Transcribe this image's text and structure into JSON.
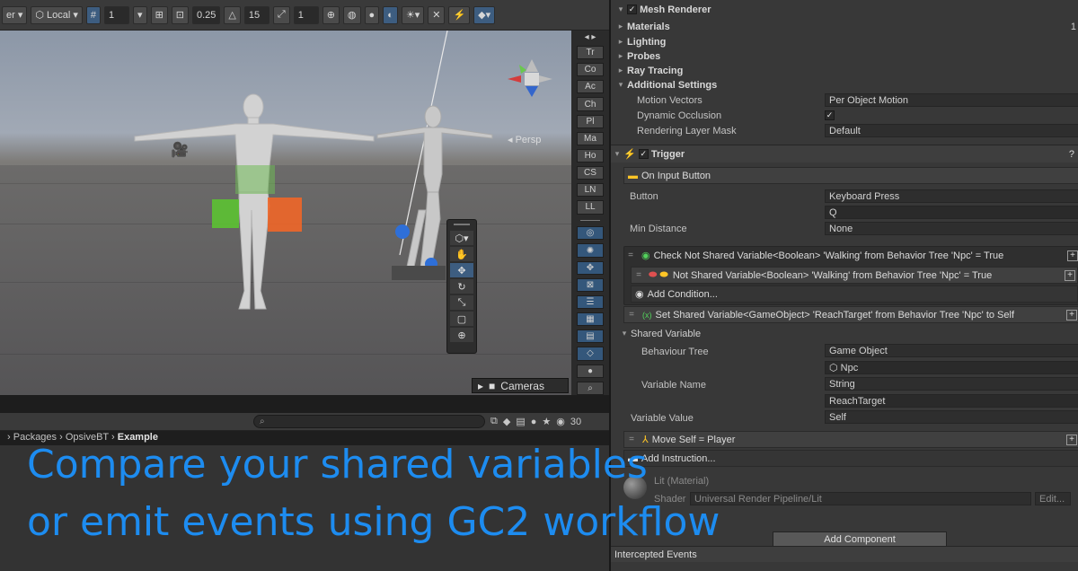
{
  "scene_toolbar": {
    "pivot_label": "er",
    "space_label": "Local",
    "grid_value": "1",
    "snap_value": "0.25",
    "rotate_snap": "15",
    "scale_snap": "1"
  },
  "scene": {
    "persp_label": "Persp",
    "cameras_label": "Cameras",
    "tools": [
      "hand-icon",
      "move-icon",
      "rotate-icon",
      "scale-icon",
      "rect-icon",
      "transform-icon"
    ],
    "overlay_buttons": [
      "Tr",
      "Co",
      "Ac",
      "Ch",
      "Pl",
      "Ma",
      "Ho",
      "CS",
      "LN",
      "LL"
    ]
  },
  "project": {
    "count": "30",
    "breadcrumb": [
      "Packages",
      "OpsiveBT",
      "Example"
    ]
  },
  "caption": {
    "line1": "Compare your shared variables",
    "line2": "or emit events using GC2 workflow"
  },
  "inspector": {
    "mesh_renderer": "Mesh Renderer",
    "top_count": "1",
    "sections": [
      "Materials",
      "Lighting",
      "Probes",
      "Ray Tracing",
      "Additional Settings"
    ],
    "motion_vectors_label": "Motion Vectors",
    "motion_vectors_value": "Per Object Motion",
    "dynamic_occlusion_label": "Dynamic Occlusion",
    "rendering_layer_mask_label": "Rendering Layer Mask",
    "rendering_layer_mask_value": "Default",
    "trigger_title": "Trigger",
    "on_input_button": "On Input Button",
    "button_label": "Button",
    "button_value": "Keyboard Press",
    "key_value": "Q",
    "min_distance_label": "Min Distance",
    "min_distance_value": "None",
    "condition_header": "Check Not Shared Variable<Boolean> 'Walking' from Behavior Tree 'Npc' = True",
    "condition_item": "Not Shared Variable<Boolean> 'Walking' from Behavior Tree 'Npc' = True",
    "add_condition": "Add Condition...",
    "set_instruction": "Set Shared Variable<GameObject> 'ReachTarget' from Behavior Tree 'Npc' to Self",
    "shared_variable_label": "Shared Variable",
    "behaviour_tree_label": "Behaviour Tree",
    "behaviour_tree_value": "Game Object",
    "npc_value": "Npc",
    "variable_name_label": "Variable Name",
    "variable_name_type": "String",
    "variable_name_value": "ReachTarget",
    "variable_value_label": "Variable Value",
    "variable_value_value": "Self",
    "move_instruction": "Move Self = Player",
    "add_instruction": "Add Instruction...",
    "material_name": "Lit (Material)",
    "shader_label": "Shader",
    "shader_value": "Universal Render Pipeline/Lit",
    "edit_label": "Edit...",
    "add_component": "Add Component",
    "intercepted_events": "Intercepted Events"
  },
  "colors": {
    "caption": "#1d8cf0",
    "accent_blue": "#3d5d80",
    "green": "#52d25b",
    "yellow": "#ffc526"
  }
}
